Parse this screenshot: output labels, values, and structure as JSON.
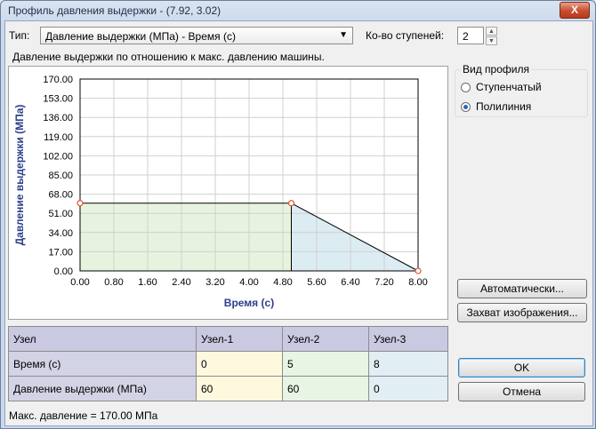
{
  "window": {
    "title": "Профиль давления выдержки - (7.92, 3.02)",
    "close_label": "X"
  },
  "top": {
    "type_label": "Тип:",
    "type_value": "Давление выдержки (МПа)   -   Время (с)",
    "steps_label": "Ко-во ступеней:",
    "steps_value": "2"
  },
  "description": "Давление выдержки по отношению к макс. давлению машины.",
  "profile_group": {
    "legend": "Вид профиля",
    "options": [
      {
        "label": "Ступенчатый",
        "selected": false
      },
      {
        "label": "Полилиния",
        "selected": true
      }
    ]
  },
  "buttons": {
    "auto": "Автоматически...",
    "capture": "Захват изображения...",
    "ok": "OK",
    "cancel": "Отмена"
  },
  "table": {
    "header": [
      "Узел",
      "Узел-1",
      "Узел-2",
      "Узел-3"
    ],
    "rows": [
      {
        "label": "Время (с)",
        "values": [
          "0",
          "5",
          "8"
        ]
      },
      {
        "label": "Давление выдержки (МПа)",
        "values": [
          "60",
          "60",
          "0"
        ]
      }
    ]
  },
  "status": "Макс. давление = 170.00 МПа",
  "chart_data": {
    "type": "line",
    "xlabel": "Время (с)",
    "ylabel": "Давление выдержки (МПа)",
    "xlim": [
      0,
      8
    ],
    "ylim": [
      0,
      170
    ],
    "xticks": [
      "0.00",
      "0.80",
      "1.60",
      "2.40",
      "3.20",
      "4.00",
      "4.80",
      "5.60",
      "6.40",
      "7.20",
      "8.00"
    ],
    "yticks": [
      "0.00",
      "17.00",
      "34.00",
      "51.00",
      "68.00",
      "85.00",
      "102.00",
      "119.00",
      "136.00",
      "153.00",
      "170.00"
    ],
    "grid": true,
    "series": [
      {
        "points": [
          [
            0,
            60
          ],
          [
            5,
            60
          ],
          [
            8,
            0
          ]
        ]
      }
    ],
    "colors": {
      "segment1_fill": "#e8f3df",
      "segment2_fill": "#dcecf3",
      "line": "#000000",
      "node": "#e0522a"
    }
  }
}
